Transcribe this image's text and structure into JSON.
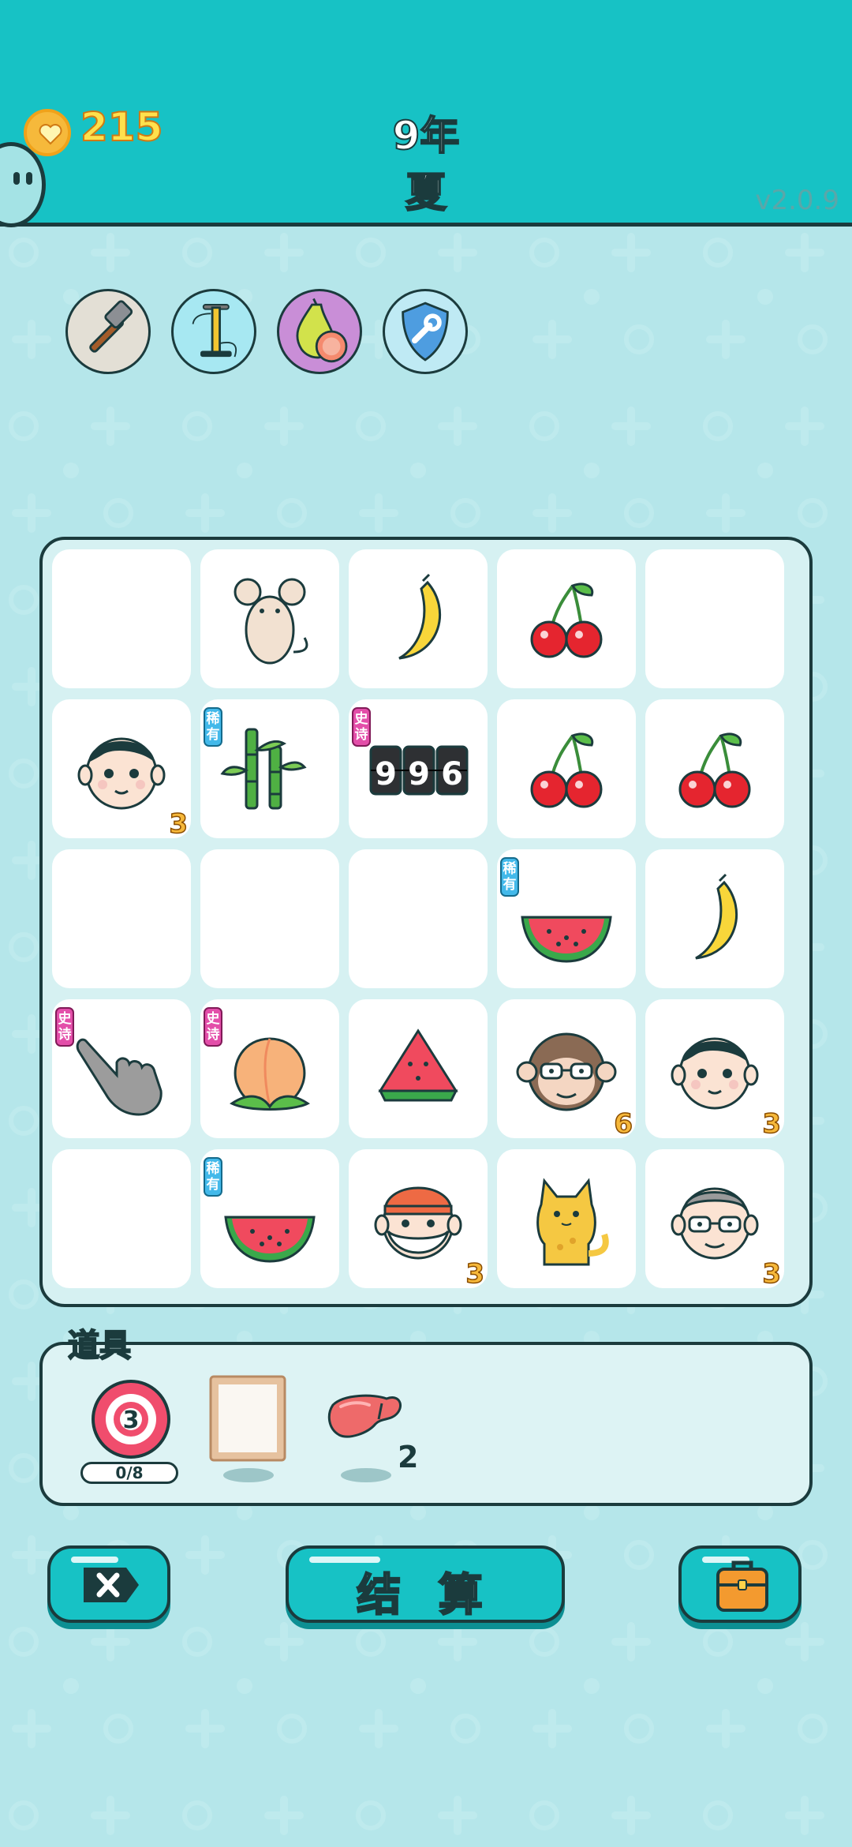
{
  "header": {
    "coins": "215",
    "year": "9年",
    "season": "夏",
    "version": "v2.0.9"
  },
  "tools": [
    {
      "name": "hammer-icon"
    },
    {
      "name": "pump-icon"
    },
    {
      "name": "pomelo-icon"
    },
    {
      "name": "shield-wrench-icon"
    }
  ],
  "board": {
    "rows": [
      [
        {
          "icon": "empty"
        },
        {
          "icon": "mouse-icon"
        },
        {
          "icon": "banana-icon"
        },
        {
          "icon": "cherry-icon"
        },
        {
          "icon": "empty"
        }
      ],
      [
        {
          "icon": "man-face-icon",
          "count": "3"
        },
        {
          "icon": "bamboo-icon",
          "tag": "稀有",
          "tag_type": "rare"
        },
        {
          "icon": "counter-996-icon",
          "tag": "史诗",
          "tag_type": "epic",
          "digits": "996"
        },
        {
          "icon": "cherry-icon"
        },
        {
          "icon": "cherry-icon"
        }
      ],
      [
        {
          "icon": "empty"
        },
        {
          "icon": "empty"
        },
        {
          "icon": "empty"
        },
        {
          "icon": "watermelon-half-icon",
          "tag": "稀有",
          "tag_type": "rare"
        },
        {
          "icon": "banana-icon"
        }
      ],
      [
        {
          "icon": "pointing-hand-icon",
          "tag": "史诗",
          "tag_type": "epic"
        },
        {
          "icon": "peach-icon",
          "tag": "史诗",
          "tag_type": "epic"
        },
        {
          "icon": "watermelon-slice-icon"
        },
        {
          "icon": "monkey-glasses-icon",
          "count": "6"
        },
        {
          "icon": "man-face-icon",
          "count": "3"
        }
      ],
      [
        {
          "icon": "empty"
        },
        {
          "icon": "watermelon-half-icon",
          "tag": "稀有",
          "tag_type": "rare"
        },
        {
          "icon": "bearded-man-cap-icon",
          "count": "3"
        },
        {
          "icon": "yellow-cat-icon"
        },
        {
          "icon": "old-man-glasses-icon",
          "count": "3"
        }
      ]
    ]
  },
  "items": {
    "title": "道具",
    "target": {
      "value": "3",
      "progress": "0/8"
    },
    "liver": {
      "count": "2"
    }
  },
  "buttons": {
    "settle_label": "结 算"
  },
  "colors": {
    "header": "#17c2c5",
    "background": "#b5e6ea",
    "outline": "#1b3b3d",
    "coin_text": "#ffe14d"
  }
}
